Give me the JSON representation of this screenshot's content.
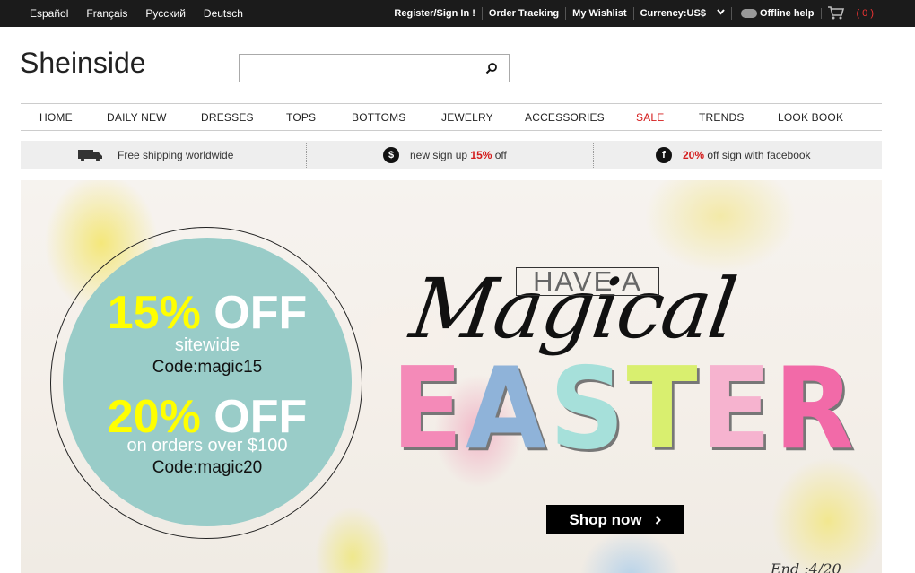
{
  "topbar": {
    "languages": [
      "Español",
      "Français",
      "Русский",
      "Deutsch"
    ],
    "register": "Register/Sign In !",
    "order_tracking": "Order Tracking",
    "wishlist": "My Wishlist",
    "currency": "Currency:US$",
    "offline_help": "Offline help",
    "cart_count": "( 0 )"
  },
  "header": {
    "logo": "Sheinside",
    "search": {
      "value": "",
      "placeholder": ""
    }
  },
  "nav": {
    "items": [
      "HOME",
      "DAILY NEW",
      "DRESSES",
      "TOPS",
      "BOTTOMS",
      "JEWELRY",
      "ACCESSORIES",
      "SALE",
      "TRENDS",
      "LOOK BOOK"
    ]
  },
  "promo": {
    "shipping": "Free shipping worldwide",
    "signup_pre": "new sign up ",
    "signup_pct": "15%",
    "signup_post": " off",
    "facebook_pct": "20%",
    "facebook_post": " off sign with facebook"
  },
  "banner": {
    "offer1_pct": "15%",
    "offer1_off": "OFF",
    "offer1_sub": "sitewide",
    "offer1_code": "Code:magic15",
    "offer2_pct": "20%",
    "offer2_off": "OFF",
    "offer2_sub": "on orders over $100",
    "offer2_code": "Code:magic20",
    "have_a": "HAVE A",
    "magical": "Magical",
    "easter_letters": [
      "E",
      "A",
      "S",
      "T",
      "E",
      "R"
    ],
    "easter_colors": [
      "#f48ab8",
      "#8fb3d9",
      "#a6e0da",
      "#d9ef6f",
      "#f6b3cf",
      "#f26aa8"
    ],
    "shop_now": "Shop now",
    "end_date": "End :4/20"
  },
  "colors": {
    "accent_red": "#d41c1c",
    "disc_teal": "#99ccc8",
    "offer_yellow": "#ffff00"
  }
}
